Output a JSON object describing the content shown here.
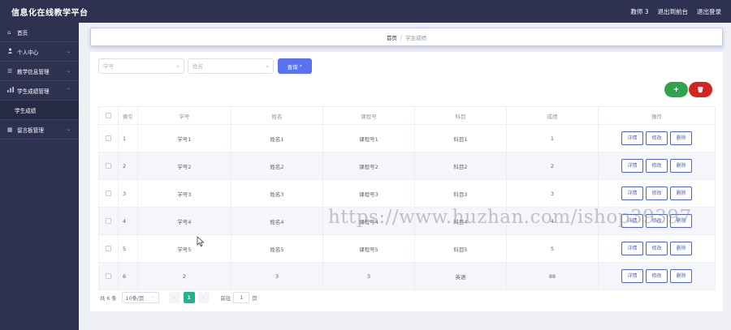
{
  "header": {
    "title": "信息化在线教学平台",
    "user": "教师 3",
    "back_to_front": "退出到前台",
    "logout": "退出登录"
  },
  "sidebar": {
    "items": [
      {
        "label": "首页",
        "icon": "home-icon",
        "chevron": ""
      },
      {
        "label": "个人中心",
        "icon": "user-icon",
        "chevron": "⌄"
      },
      {
        "label": "教学信息管理",
        "icon": "list-icon",
        "chevron": "⌄"
      },
      {
        "label": "学生成绩管理",
        "icon": "chart-icon",
        "chevron": "⌃",
        "expanded": true,
        "children": [
          {
            "label": "学生成绩"
          }
        ]
      },
      {
        "label": "留言板管理",
        "icon": "grid-icon",
        "chevron": "⌄"
      }
    ]
  },
  "breadcrumb": {
    "home": "首页",
    "separator": "/",
    "current": "学生成绩"
  },
  "search": {
    "student_no_placeholder": "学号",
    "name_placeholder": "姓名",
    "query_label": "查询"
  },
  "toolbar": {
    "add_label": "+",
    "delete_label": "🗑"
  },
  "table": {
    "headers": [
      "",
      "索引",
      "学号",
      "姓名",
      "课程号",
      "科目",
      "成绩",
      "操作"
    ],
    "rows": [
      {
        "index": "1",
        "student_no": "学号1",
        "name": "姓名1",
        "course_no": "课程号1",
        "subject": "科目1",
        "score": "1"
      },
      {
        "index": "2",
        "student_no": "学号2",
        "name": "姓名2",
        "course_no": "课程号2",
        "subject": "科目2",
        "score": "2"
      },
      {
        "index": "3",
        "student_no": "学号3",
        "name": "姓名3",
        "course_no": "课程号3",
        "subject": "科目3",
        "score": "3"
      },
      {
        "index": "4",
        "student_no": "学号4",
        "name": "姓名4",
        "course_no": "课程号4",
        "subject": "科目4",
        "score": "4"
      },
      {
        "index": "5",
        "student_no": "学号5",
        "name": "姓名5",
        "course_no": "课程号5",
        "subject": "科目5",
        "score": "5"
      },
      {
        "index": "6",
        "student_no": "2",
        "name": "3",
        "course_no": "3",
        "subject": "英语",
        "score": "88"
      }
    ],
    "actions": {
      "detail": "详情",
      "edit": "修改",
      "delete": "删除"
    }
  },
  "pagination": {
    "total": "共 6 条",
    "page_size": "10条/页",
    "prev": "‹",
    "current_page": "1",
    "next": "›",
    "goto_label": "前往",
    "goto_value": "1",
    "page_unit": "页"
  },
  "watermark": "https://www.huzhan.com/ishop39397",
  "colors": {
    "sidebar": "#2e3250",
    "primary": "#5b72f0",
    "add": "#2ea44f",
    "delete": "#d42323",
    "pager_active": "#22b28c",
    "action_border": "#4a63d8"
  }
}
